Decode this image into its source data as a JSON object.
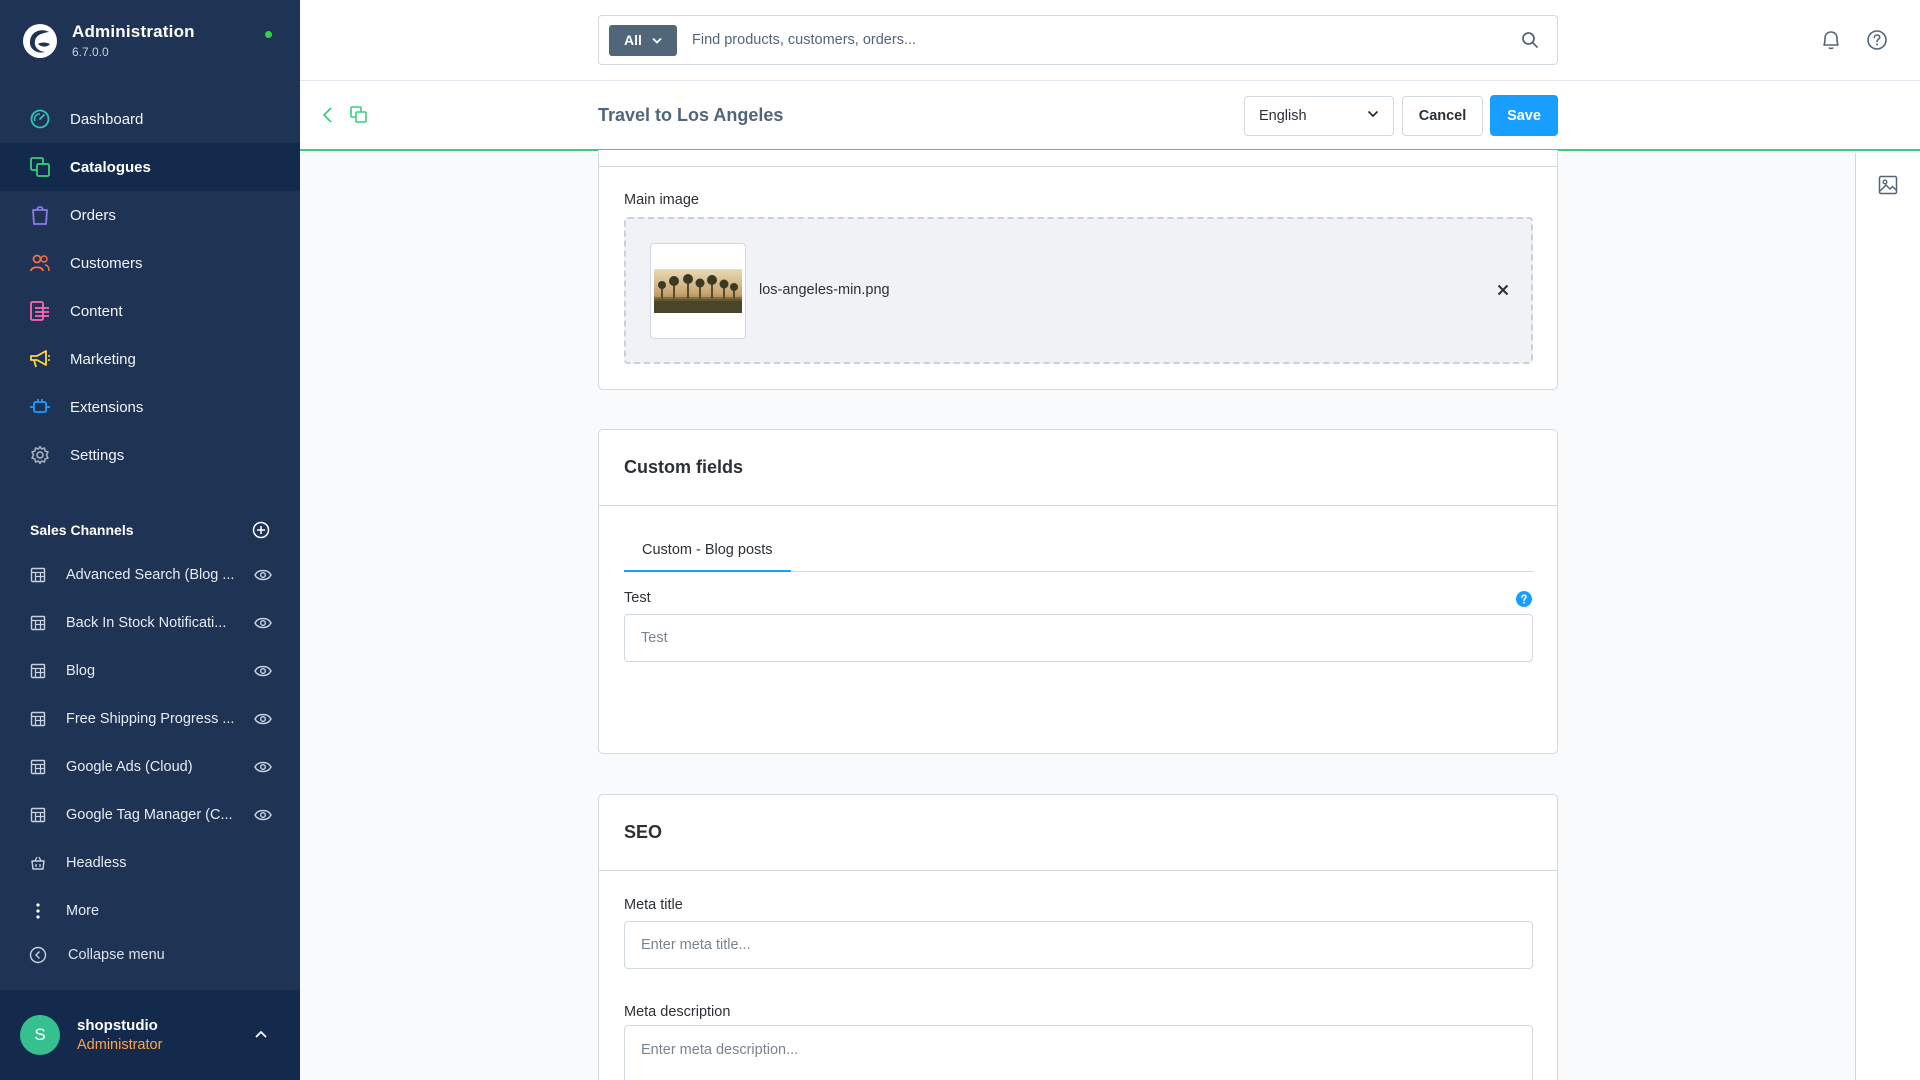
{
  "app": {
    "title": "Administration",
    "version": "6.7.0.0"
  },
  "nav": [
    {
      "label": "Dashboard",
      "icon": "dashboard-icon",
      "active": false,
      "color": "#2ec4b6"
    },
    {
      "label": "Catalogues",
      "icon": "catalogues-icon",
      "active": true,
      "color": "#37d07a"
    },
    {
      "label": "Orders",
      "icon": "orders-icon",
      "active": false,
      "color": "#8c7ae6"
    },
    {
      "label": "Customers",
      "icon": "customers-icon",
      "active": false,
      "color": "#ff6b4a"
    },
    {
      "label": "Content",
      "icon": "content-icon",
      "active": false,
      "color": "#ff68b4"
    },
    {
      "label": "Marketing",
      "icon": "marketing-icon",
      "active": false,
      "color": "#ffd740"
    },
    {
      "label": "Extensions",
      "icon": "extensions-icon",
      "active": false,
      "color": "#189eff"
    },
    {
      "label": "Settings",
      "icon": "settings-icon",
      "active": false,
      "color": "#a8b4c4"
    }
  ],
  "sales_channels": {
    "title": "Sales Channels",
    "items": [
      {
        "label": "Advanced Search (Blog ...",
        "icon": "storefront-icon",
        "visible": true
      },
      {
        "label": "Back In Stock Notificati...",
        "icon": "storefront-icon",
        "visible": true
      },
      {
        "label": "Blog",
        "icon": "storefront-icon",
        "visible": true
      },
      {
        "label": "Free Shipping Progress ...",
        "icon": "storefront-icon",
        "visible": true
      },
      {
        "label": "Google Ads (Cloud)",
        "icon": "storefront-icon",
        "visible": true
      },
      {
        "label": "Google Tag Manager (C...",
        "icon": "storefront-icon",
        "visible": true
      },
      {
        "label": "Headless",
        "icon": "headless-icon",
        "visible": false
      },
      {
        "label": "More",
        "icon": "more-icon",
        "visible": false
      }
    ]
  },
  "collapse_label": "Collapse menu",
  "user": {
    "initial": "S",
    "name": "shopstudio",
    "role": "Administrator"
  },
  "search": {
    "type": "All",
    "placeholder": "Find products, customers, orders..."
  },
  "smartbar": {
    "title": "Travel to Los Angeles",
    "language": "English",
    "cancel": "Cancel",
    "save": "Save"
  },
  "media": {
    "label": "Main image",
    "file_name": "los-angeles-min.png"
  },
  "custom_fields": {
    "title": "Custom fields",
    "tab": "Custom - Blog posts",
    "field_label": "Test",
    "field_placeholder": "Test"
  },
  "seo": {
    "title": "SEO",
    "meta_title_label": "Meta title",
    "meta_title_placeholder": "Enter meta title...",
    "meta_desc_label": "Meta description",
    "meta_desc_placeholder": "Enter meta description..."
  },
  "colors": {
    "sidebar": "#1f3354",
    "accent": "#189eff",
    "success": "#37d07a",
    "role": "#ffa24a"
  }
}
